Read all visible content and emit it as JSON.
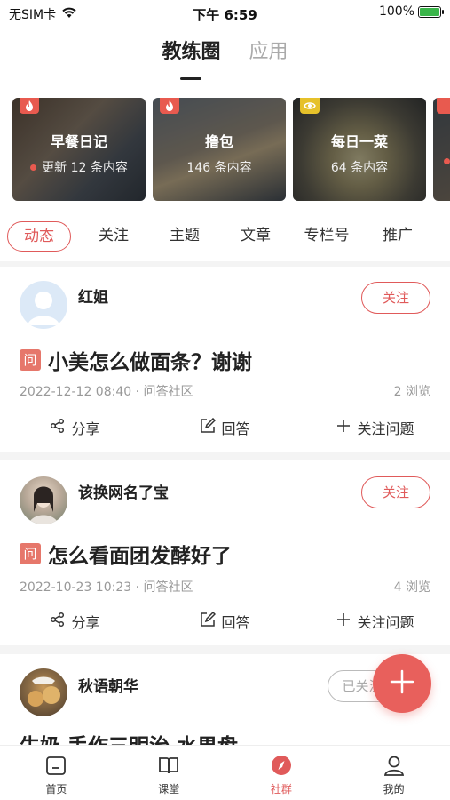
{
  "status_bar": {
    "carrier": "无SIM卡",
    "time": "下午 6:59",
    "battery": "100%"
  },
  "top_tabs": [
    {
      "label": "教练圈",
      "active": true
    },
    {
      "label": "应用",
      "active": false
    }
  ],
  "cards": [
    {
      "badge": "fire-icon",
      "badge_color": "#e85a4f",
      "title": "早餐日记",
      "subtitle": "更新 12 条内容",
      "has_dot": true
    },
    {
      "badge": "fire-icon",
      "badge_color": "#e85a4f",
      "title": "撸包",
      "subtitle": "146 条内容",
      "has_dot": false
    },
    {
      "badge": "eye-icon",
      "badge_color": "#e6c12a",
      "title": "每日一菜",
      "subtitle": "64 条内容",
      "has_dot": false
    }
  ],
  "sub_tabs": [
    {
      "label": "动态",
      "active": true
    },
    {
      "label": "关注",
      "active": false
    },
    {
      "label": "主题",
      "active": false
    },
    {
      "label": "文章",
      "active": false
    },
    {
      "label": "专栏号",
      "active": false
    },
    {
      "label": "推广",
      "active": false
    }
  ],
  "posts": [
    {
      "username": "红姐",
      "follow_label": "关注",
      "q_badge": "问",
      "title": "小美怎么做面条？谢谢",
      "meta": "2022-12-12 08:40 · 问答社区",
      "views": "2 浏览",
      "actions": {
        "share": "分享",
        "answer": "回答",
        "follow_q": "关注问题"
      }
    },
    {
      "username": "该换网名了宝",
      "follow_label": "关注",
      "q_badge": "问",
      "title": "怎么看面团发酵好了",
      "meta": "2022-10-23 10:23 · 问答社区",
      "views": "4 浏览",
      "actions": {
        "share": "分享",
        "answer": "回答",
        "follow_q": "关注问题"
      }
    },
    {
      "username": "秋语朝华",
      "follow_label": "已关注",
      "title": "牛奶  手作三明治  水果盘"
    }
  ],
  "bottom_nav": [
    {
      "label": "首页",
      "icon": "home-icon",
      "active": false
    },
    {
      "label": "课堂",
      "icon": "book-icon",
      "active": false
    },
    {
      "label": "社群",
      "icon": "compass-icon",
      "active": true
    },
    {
      "label": "我的",
      "icon": "profile-icon",
      "active": false
    }
  ],
  "colors": {
    "accent": "#e05a5a",
    "fab": "#e8605c"
  }
}
